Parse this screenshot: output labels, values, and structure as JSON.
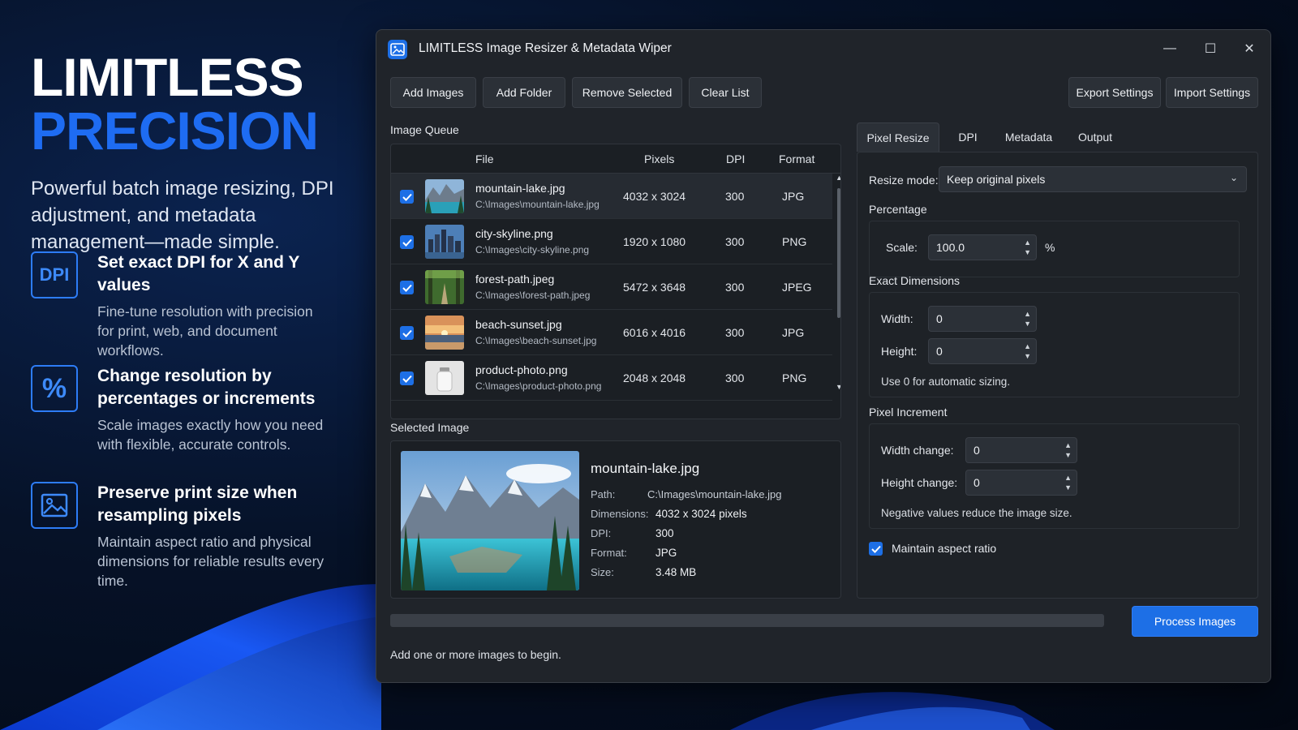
{
  "promo": {
    "title_line1": "LIMITLESS",
    "title_line2": "PRECISION",
    "tagline": "Powerful batch image resizing, DPI adjustment, and metadata management—made simple.",
    "features": [
      {
        "icon": "dpi-icon",
        "icon_text": "DPI",
        "title": "Set exact DPI for X and Y values",
        "desc": "Fine-tune resolution with precision for print, web, and document workflows."
      },
      {
        "icon": "percent-icon",
        "icon_text": "%",
        "title": "Change resolution by percentages or increments",
        "desc": "Scale images exactly how you need with flexible, accurate controls."
      },
      {
        "icon": "image-icon",
        "title": "Preserve print size when resampling pixels",
        "desc": "Maintain aspect ratio and physical dimensions for reliable results every time."
      }
    ]
  },
  "window": {
    "title": "LIMITLESS Image Resizer & Metadata Wiper",
    "controls": {
      "minimize": "—",
      "maximize": "☐",
      "close": "✕"
    }
  },
  "toolbar": {
    "add_images": "Add Images",
    "add_folder": "Add Folder",
    "remove_selected": "Remove Selected",
    "clear_list": "Clear List",
    "export_settings": "Export Settings",
    "import_settings": "Import Settings"
  },
  "queue": {
    "label": "Image Queue",
    "columns": {
      "file": "File",
      "pixels": "Pixels",
      "dpi": "DPI",
      "format": "Format"
    },
    "rows": [
      {
        "name": "mountain-lake.jpg",
        "path": "C:\\Images\\mountain-lake.jpg",
        "pixels": "4032 x 3024",
        "dpi": "300",
        "format": "JPG",
        "checked": true
      },
      {
        "name": "city-skyline.png",
        "path": "C:\\Images\\city-skyline.png",
        "pixels": "1920 x 1080",
        "dpi": "300",
        "format": "PNG",
        "checked": true
      },
      {
        "name": "forest-path.jpeg",
        "path": "C:\\Images\\forest-path.jpeg",
        "pixels": "5472 x 3648",
        "dpi": "300",
        "format": "JPEG",
        "checked": true
      },
      {
        "name": "beach-sunset.jpg",
        "path": "C:\\Images\\beach-sunset.jpg",
        "pixels": "6016 x 4016",
        "dpi": "300",
        "format": "JPG",
        "checked": true
      },
      {
        "name": "product-photo.png",
        "path": "C:\\Images\\product-photo.png",
        "pixels": "2048 x 2048",
        "dpi": "300",
        "format": "PNG",
        "checked": true
      }
    ]
  },
  "selected": {
    "label": "Selected Image",
    "name": "mountain-lake.jpg",
    "path_label": "Path:",
    "path": "C:\\Images\\mountain-lake.jpg",
    "dimensions_label": "Dimensions:",
    "dimensions": "4032 x 3024 pixels",
    "dpi_label": "DPI:",
    "dpi": "300",
    "format_label": "Format:",
    "format": "JPG",
    "size_label": "Size:",
    "size": "3.48 MB"
  },
  "tabs": [
    "Pixel Resize",
    "DPI",
    "Metadata",
    "Output"
  ],
  "settings": {
    "resize_mode_label": "Resize mode:",
    "resize_mode_value": "Keep original pixels",
    "percentage_header": "Percentage",
    "scale_label": "Scale:",
    "scale_value": "100.0",
    "scale_unit": "%",
    "exact_header": "Exact Dimensions",
    "width_label": "Width:",
    "width_value": "0",
    "height_label": "Height:",
    "height_value": "0",
    "exact_hint": "Use 0 for automatic sizing.",
    "increment_header": "Pixel Increment",
    "width_change_label": "Width change:",
    "width_change_value": "0",
    "height_change_label": "Height change:",
    "height_change_value": "0",
    "increment_hint": "Negative values reduce the image size.",
    "maintain_aspect_label": "Maintain aspect ratio",
    "maintain_aspect_checked": true
  },
  "footer": {
    "progress": 0,
    "process_button": "Process Images",
    "status": "Add one or more images to begin."
  },
  "colors": {
    "accent": "#1d6fe6",
    "brand_blue": "#1e6cf2"
  }
}
